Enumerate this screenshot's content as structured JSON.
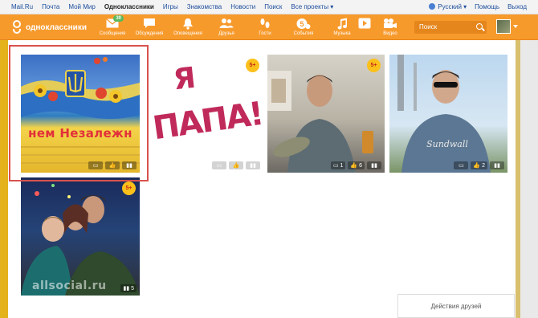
{
  "topbar": {
    "links": [
      "Mail.Ru",
      "Почта",
      "Мой Мир",
      "Одноклассники",
      "Игры",
      "Знакомства",
      "Новости",
      "Поиск",
      "Все проекты ▾"
    ],
    "active_index": 3,
    "language": "Русский ▾",
    "help": "Помощь",
    "logout": "Выход"
  },
  "navbar": {
    "logo_text": "одноклассники",
    "items": [
      {
        "label": "Сообщения",
        "icon": "envelope-icon",
        "badge": "30"
      },
      {
        "label": "Обсуждения",
        "icon": "chat-bubble-icon"
      },
      {
        "label": "Оповещения",
        "icon": "bell-icon"
      },
      {
        "label": "Друзья",
        "icon": "friends-icon"
      },
      {
        "label": "Гости",
        "icon": "footprints-icon"
      },
      {
        "label": "События",
        "icon": "events-icon"
      },
      {
        "label": "Музыка",
        "icon": "music-note-icon"
      },
      {
        "label": "",
        "icon": "play-icon"
      },
      {
        "label": "Видео",
        "icon": "video-camera-icon"
      }
    ],
    "search_placeholder": "Поиск"
  },
  "photos": [
    {
      "id": "p1",
      "age_badge": "",
      "stats": []
    },
    {
      "id": "p2",
      "caption": "Я ПАПА!",
      "age_badge": "5+",
      "stats": []
    },
    {
      "id": "p3",
      "age_badge": "5+",
      "stats": [
        "1",
        "6",
        ""
      ]
    },
    {
      "id": "p4",
      "age_badge": "",
      "stats": [
        "",
        "2",
        ""
      ]
    },
    {
      "id": "p5",
      "age_badge": "5+",
      "stats": [
        "5"
      ]
    }
  ],
  "highlighted_photo_text": "нем Незалежн",
  "friends_actions": "Действия друзей",
  "watermark": "allsocial.ru",
  "colors": {
    "orange": "#f79a2c",
    "highlight": "#d9534f",
    "badge_green": "#5cb85c"
  }
}
